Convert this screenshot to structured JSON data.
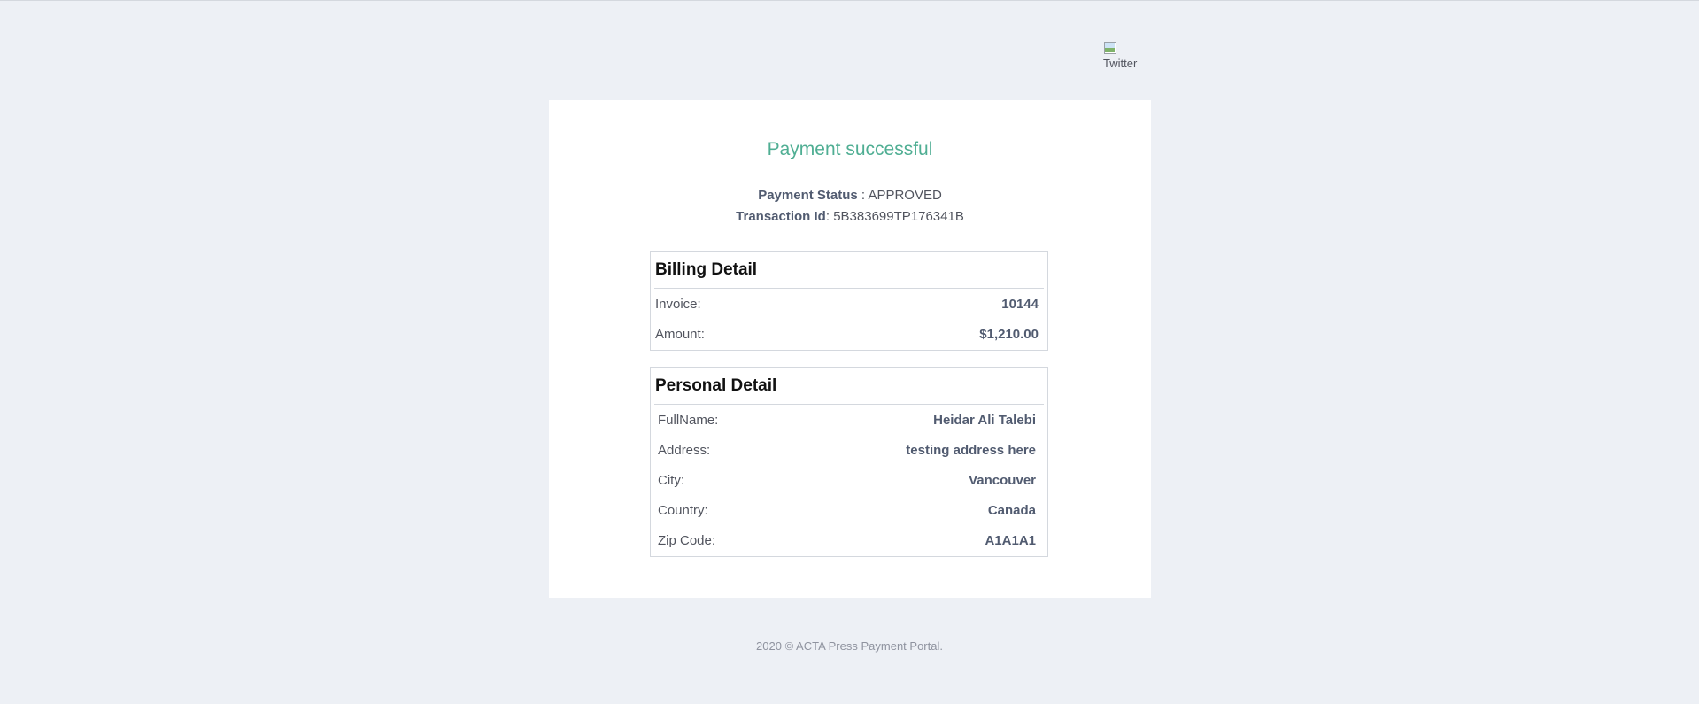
{
  "logo": {
    "alt": "Twitter"
  },
  "header": {
    "title": "Payment successful"
  },
  "payment": {
    "status_label": "Payment Status",
    "status_value": "APPROVED",
    "transaction_label": "Transaction Id",
    "transaction_value": "5B383699TP176341B"
  },
  "billing": {
    "heading": "Billing Detail",
    "rows": [
      {
        "label": "Invoice:",
        "value": "10144"
      },
      {
        "label": "Amount:",
        "value": "$1,210.00"
      }
    ]
  },
  "personal": {
    "heading": "Personal Detail",
    "rows": [
      {
        "label": "FullName:",
        "value": "Heidar Ali Talebi"
      },
      {
        "label": "Address:",
        "value": "testing address here"
      },
      {
        "label": "City:",
        "value": "Vancouver"
      },
      {
        "label": "Country:",
        "value": "Canada"
      },
      {
        "label": "Zip Code:",
        "value": "A1A1A1"
      }
    ]
  },
  "footer": {
    "text": "2020 © ACTA Press Payment Portal."
  },
  "colors": {
    "page_bg": "#edf0f5",
    "accent": "#4fae93",
    "text": "#51545e",
    "border": "#d4d8de"
  }
}
